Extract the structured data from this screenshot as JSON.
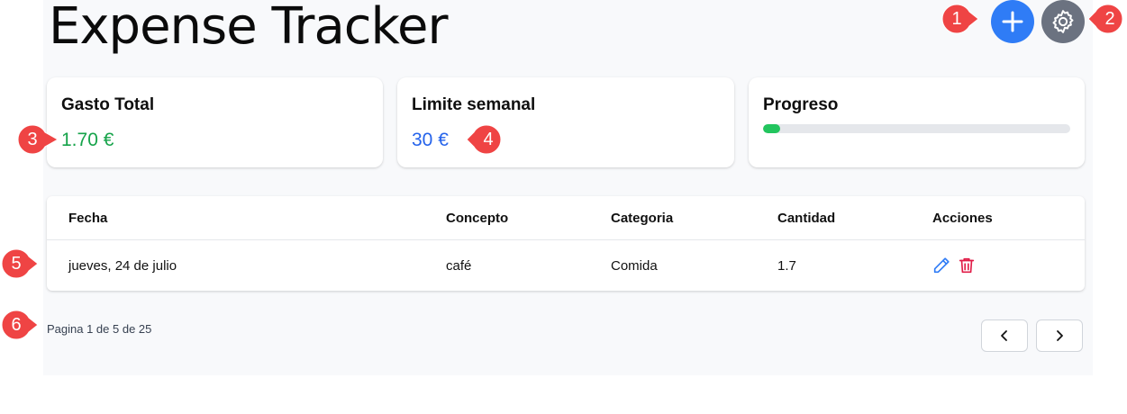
{
  "app": {
    "title": "Expense Tracker"
  },
  "summary": {
    "total_label": "Gasto Total",
    "total_value": "1.70 €",
    "limit_label": "Limite semanal",
    "limit_value": "30 €",
    "progress_label": "Progreso",
    "progress_fraction": 0.057
  },
  "table": {
    "headers": [
      "Fecha",
      "Concepto",
      "Categoria",
      "Cantidad",
      "Acciones"
    ],
    "rows": [
      {
        "fecha": "jueves, 24 de julio",
        "concepto": "café",
        "categoria": "Comida",
        "cantidad": "1.7"
      }
    ]
  },
  "pagination": {
    "text": "Pagina 1 de 5 de 25"
  },
  "annotations": [
    "1",
    "2",
    "3",
    "4",
    "5",
    "6"
  ],
  "icons": {
    "add": "plus-icon",
    "settings": "gear-icon",
    "edit": "pencil-icon",
    "delete": "trash-icon",
    "prev": "chevron-left-icon",
    "next": "chevron-right-icon"
  },
  "colors": {
    "accent": "#2f7cf6",
    "settings": "#6b7280",
    "positive": "#16a34a",
    "limit": "#2563eb",
    "progress": "#22c55e",
    "danger": "#e11d48",
    "marker": "#ef4444"
  }
}
